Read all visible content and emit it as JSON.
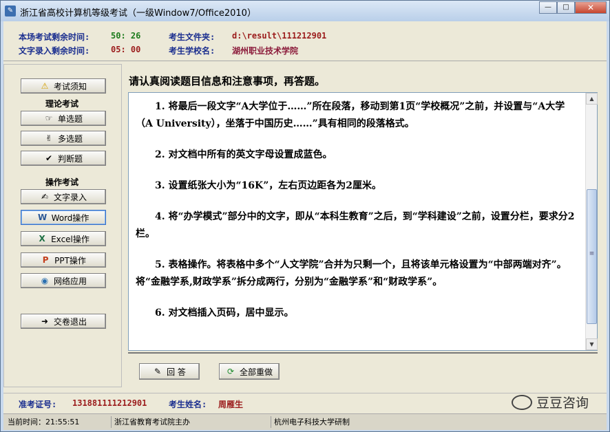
{
  "window": {
    "title": "浙江省高校计算机等级考试（一级Window7/Office2010）",
    "min": "—",
    "max": "□",
    "close": "✕"
  },
  "info": {
    "exam_time_label": "本场考试剩余时间:",
    "exam_time_value": "50: 26",
    "typing_time_label": "文字录入剩余时间:",
    "typing_time_value": "05: 00",
    "folder_label": "考生文件夹:",
    "folder_value": "d:\\result\\111212901",
    "school_label": "考生学校名:",
    "school_value": "湖州职业技术学院"
  },
  "sidebar": {
    "notice_btn": "考试须知",
    "theory_title": "理论考试",
    "single_btn": "单选题",
    "multi_btn": "多选题",
    "judge_btn": "判断题",
    "op_title": "操作考试",
    "typing_btn": "文字录入",
    "word_btn": "Word操作",
    "excel_btn": "Excel操作",
    "ppt_btn": "PPT操作",
    "net_btn": "网络应用",
    "submit_btn": "交卷退出"
  },
  "main": {
    "header": "请认真阅读题目信息和注意事项，再答题。",
    "questions": [
      "1. 将最后一段文字“A大学位于……”所在段落，移动到第1页“学校概况”之前，并设置与“A大学（A University），坐落于中国历史……”具有相同的段落格式。",
      "2. 对文档中所有的英文字母设置成蓝色。",
      "3. 设置纸张大小为“16K”，左右页边距各为2厘米。",
      "4. 将“办学模式”部分中的文字，即从“本科生教育”之后，到“学科建设”之前，设置分栏，要求分2栏。",
      "5. 表格操作。将表格中多个“人文学院”合并为只剩一个，且将该单元格设置为“中部两端对齐”。将“金融学系,财政学系”拆分成两行，分别为“金融学系”和“财政学系”。",
      "6. 对文档插入页码，居中显示。"
    ],
    "answer_btn": "回 答",
    "redo_btn": "全部重做"
  },
  "footer": {
    "id_label": "准考证号:",
    "id_value": "131881111212901",
    "name_label": "考生姓名:",
    "name_value": "周雁生"
  },
  "status": {
    "time": "当前时间：21:55:51",
    "host": "浙江省教育考试院主办",
    "dev": "杭州电子科技大学研制"
  },
  "watermark": "豆豆咨询"
}
